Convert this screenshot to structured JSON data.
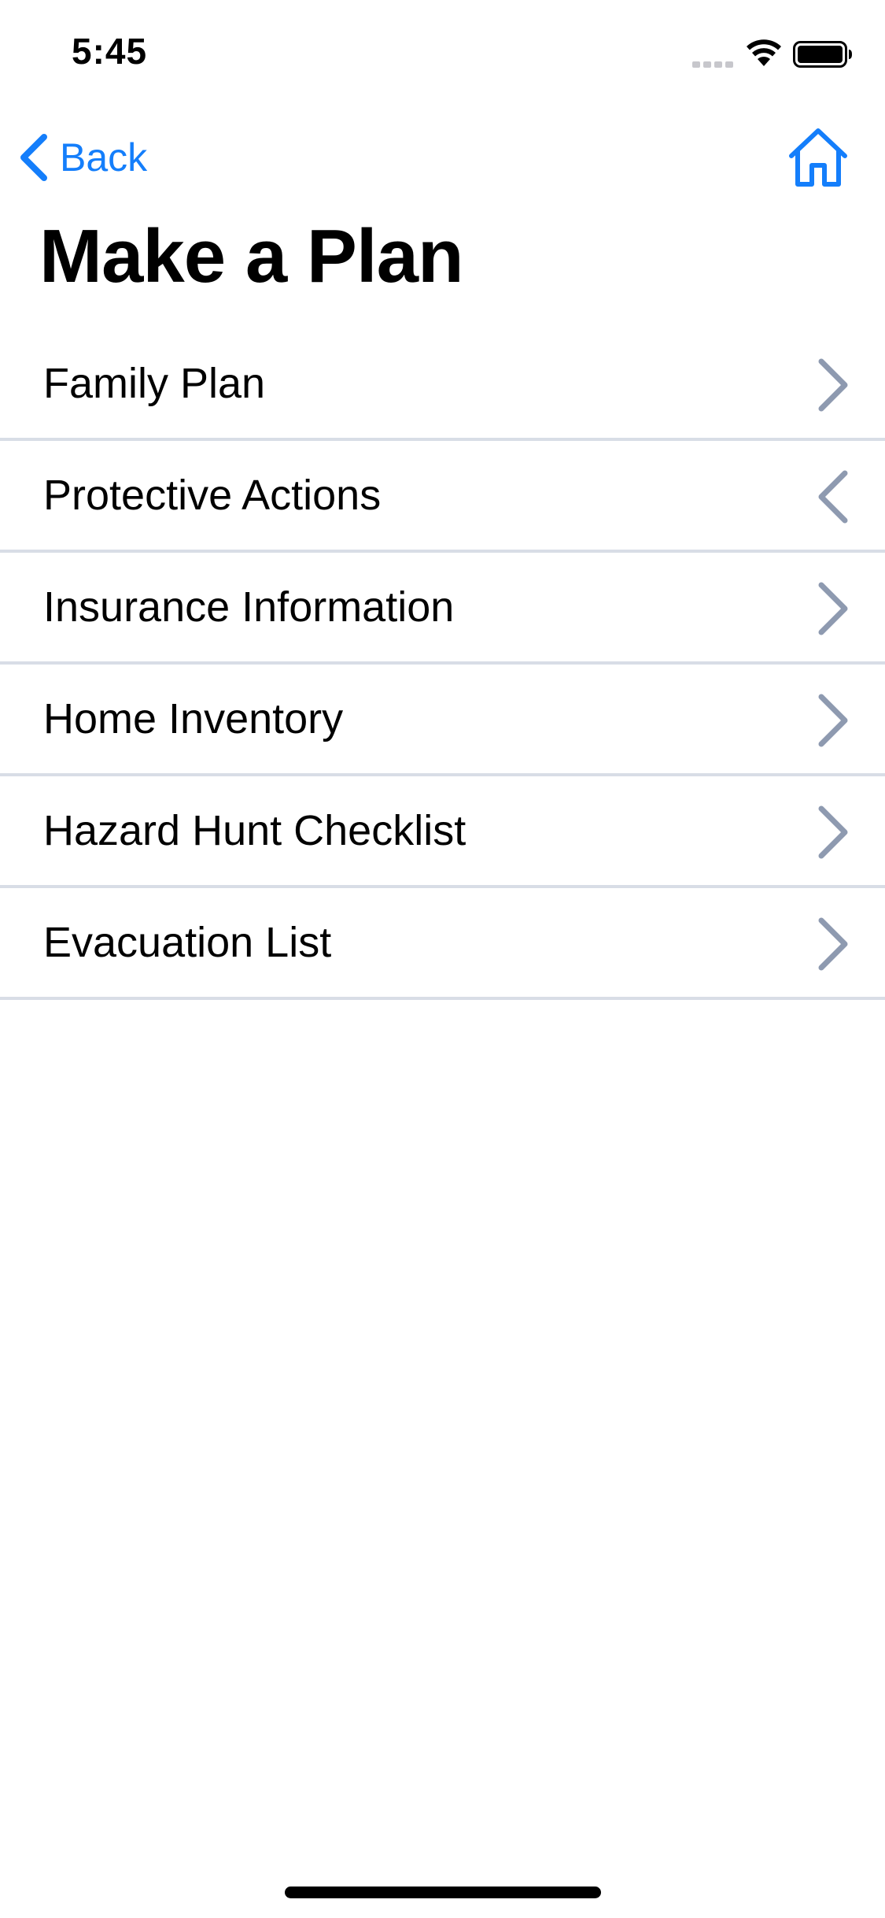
{
  "status_bar": {
    "time": "5:45"
  },
  "nav": {
    "back_label": "Back",
    "accent_color": "#147efb"
  },
  "title": "Make a Plan",
  "menu": {
    "chevron_color": "#8e9ab0",
    "items": [
      {
        "label": "Family Plan",
        "chevron": "chevron-right-icon"
      },
      {
        "label": "Protective Actions",
        "chevron": "chevron-left-icon"
      },
      {
        "label": "Insurance Information",
        "chevron": "chevron-right-icon"
      },
      {
        "label": "Home Inventory",
        "chevron": "chevron-right-icon"
      },
      {
        "label": "Hazard Hunt Checklist",
        "chevron": "chevron-right-icon"
      },
      {
        "label": "Evacuation List",
        "chevron": "chevron-right-icon"
      }
    ]
  }
}
